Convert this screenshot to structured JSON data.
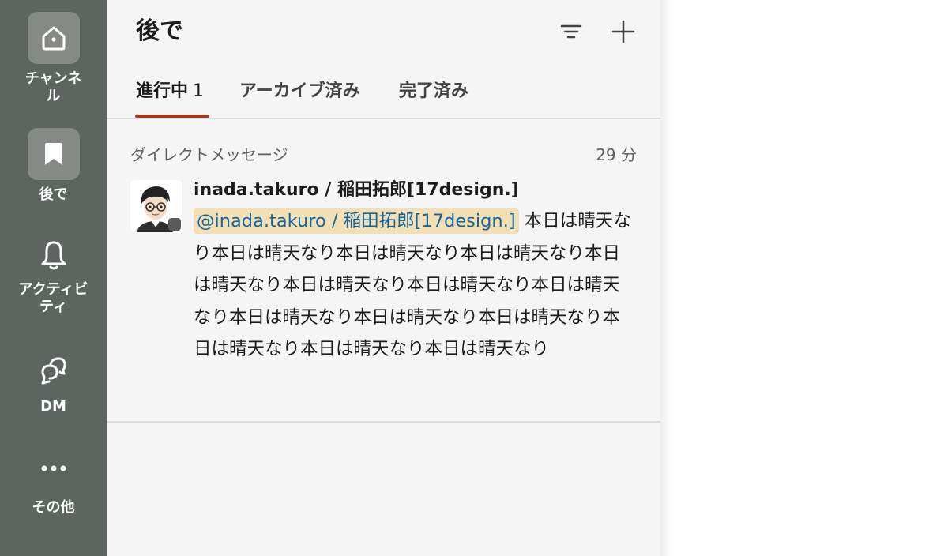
{
  "sidebar": {
    "items": [
      {
        "label": "チャンネル",
        "icon": "home-icon",
        "active": false
      },
      {
        "label": "後で",
        "icon": "bookmark-icon",
        "active": true
      },
      {
        "label": "アクティビティ",
        "icon": "bell-icon",
        "active": false
      },
      {
        "label": "DM",
        "icon": "chat-bubble-icon",
        "active": false
      },
      {
        "label": "その他",
        "icon": "more-icon",
        "active": false
      }
    ]
  },
  "header": {
    "title": "後で",
    "filter_icon": "filter-icon",
    "add_icon": "plus-icon"
  },
  "tabs": [
    {
      "label": "進行中",
      "count": "1",
      "active": true
    },
    {
      "label": "アーカイブ済み",
      "active": false
    },
    {
      "label": "完了済み",
      "active": false
    }
  ],
  "items": [
    {
      "section": "ダイレクトメッセージ",
      "time": "29 分",
      "sender": "inada.takuro / 稲田拓郎[17design.]",
      "mention": "@inada.takuro / 稲田拓郎[17design.]",
      "message": "本日は晴天なり本日は晴天なり本日は晴天なり本日は晴天なり本日は晴天なり本日は晴天なり本日は晴天なり本日は晴天なり本日は晴天なり本日は晴天なり本日は晴天なり本日は晴天なり本日は晴天なり本日は晴天なり"
    }
  ],
  "colors": {
    "sidebar_bg": "#5e6460",
    "active_item_bg": "#858a86",
    "tab_underline": "#b0310f",
    "mention_bg": "#f2dfb3",
    "mention_text": "#1264a3"
  }
}
